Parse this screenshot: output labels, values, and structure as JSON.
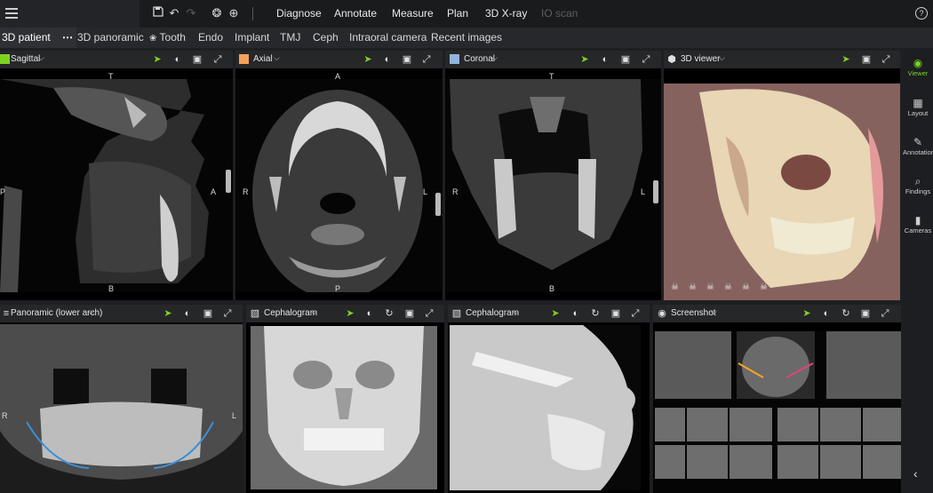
{
  "toolbar": {
    "menu": [
      "Diagnose",
      "Annotate",
      "Measure",
      "Plan",
      "3D X-ray",
      "IO scan"
    ],
    "icons": [
      "save-icon",
      "undo-icon",
      "redo-icon",
      "aperture-icon",
      "target-icon",
      "help-icon"
    ]
  },
  "tabs": {
    "active": "3D patient",
    "more": "⋯",
    "items": [
      "3D panoramic",
      "Tooth",
      "Endo",
      "Implant",
      "TMJ",
      "Ceph",
      "Intraoral camera",
      "Recent images"
    ]
  },
  "panels": {
    "sagittal": {
      "title": "Sagittal",
      "color": "#7ed321",
      "top": "T",
      "left": "P",
      "right": "A",
      "bottom": "B"
    },
    "axial": {
      "title": "Axial",
      "color": "#f5a05a",
      "top": "A",
      "left": "R",
      "right": "L",
      "bottom": "P"
    },
    "coronal": {
      "title": "Coronal",
      "color": "#8fb4dd",
      "top": "T",
      "left": "R",
      "right": "L",
      "bottom": "B"
    },
    "viewer3d": {
      "title": "3D viewer"
    },
    "panoramic": {
      "title": "Panoramic (lower arch)",
      "left": "R",
      "right": "L"
    },
    "ceph1": {
      "title": "Cephalogram"
    },
    "ceph2": {
      "title": "Cephalogram"
    },
    "screenshot": {
      "title": "Screenshot"
    }
  },
  "sidebar": {
    "items": [
      "Viewer",
      "Layout",
      "Annotations",
      "Findings",
      "Cameras"
    ]
  },
  "colors": {
    "accent": "#7ed321",
    "panel_header": "#262729"
  }
}
